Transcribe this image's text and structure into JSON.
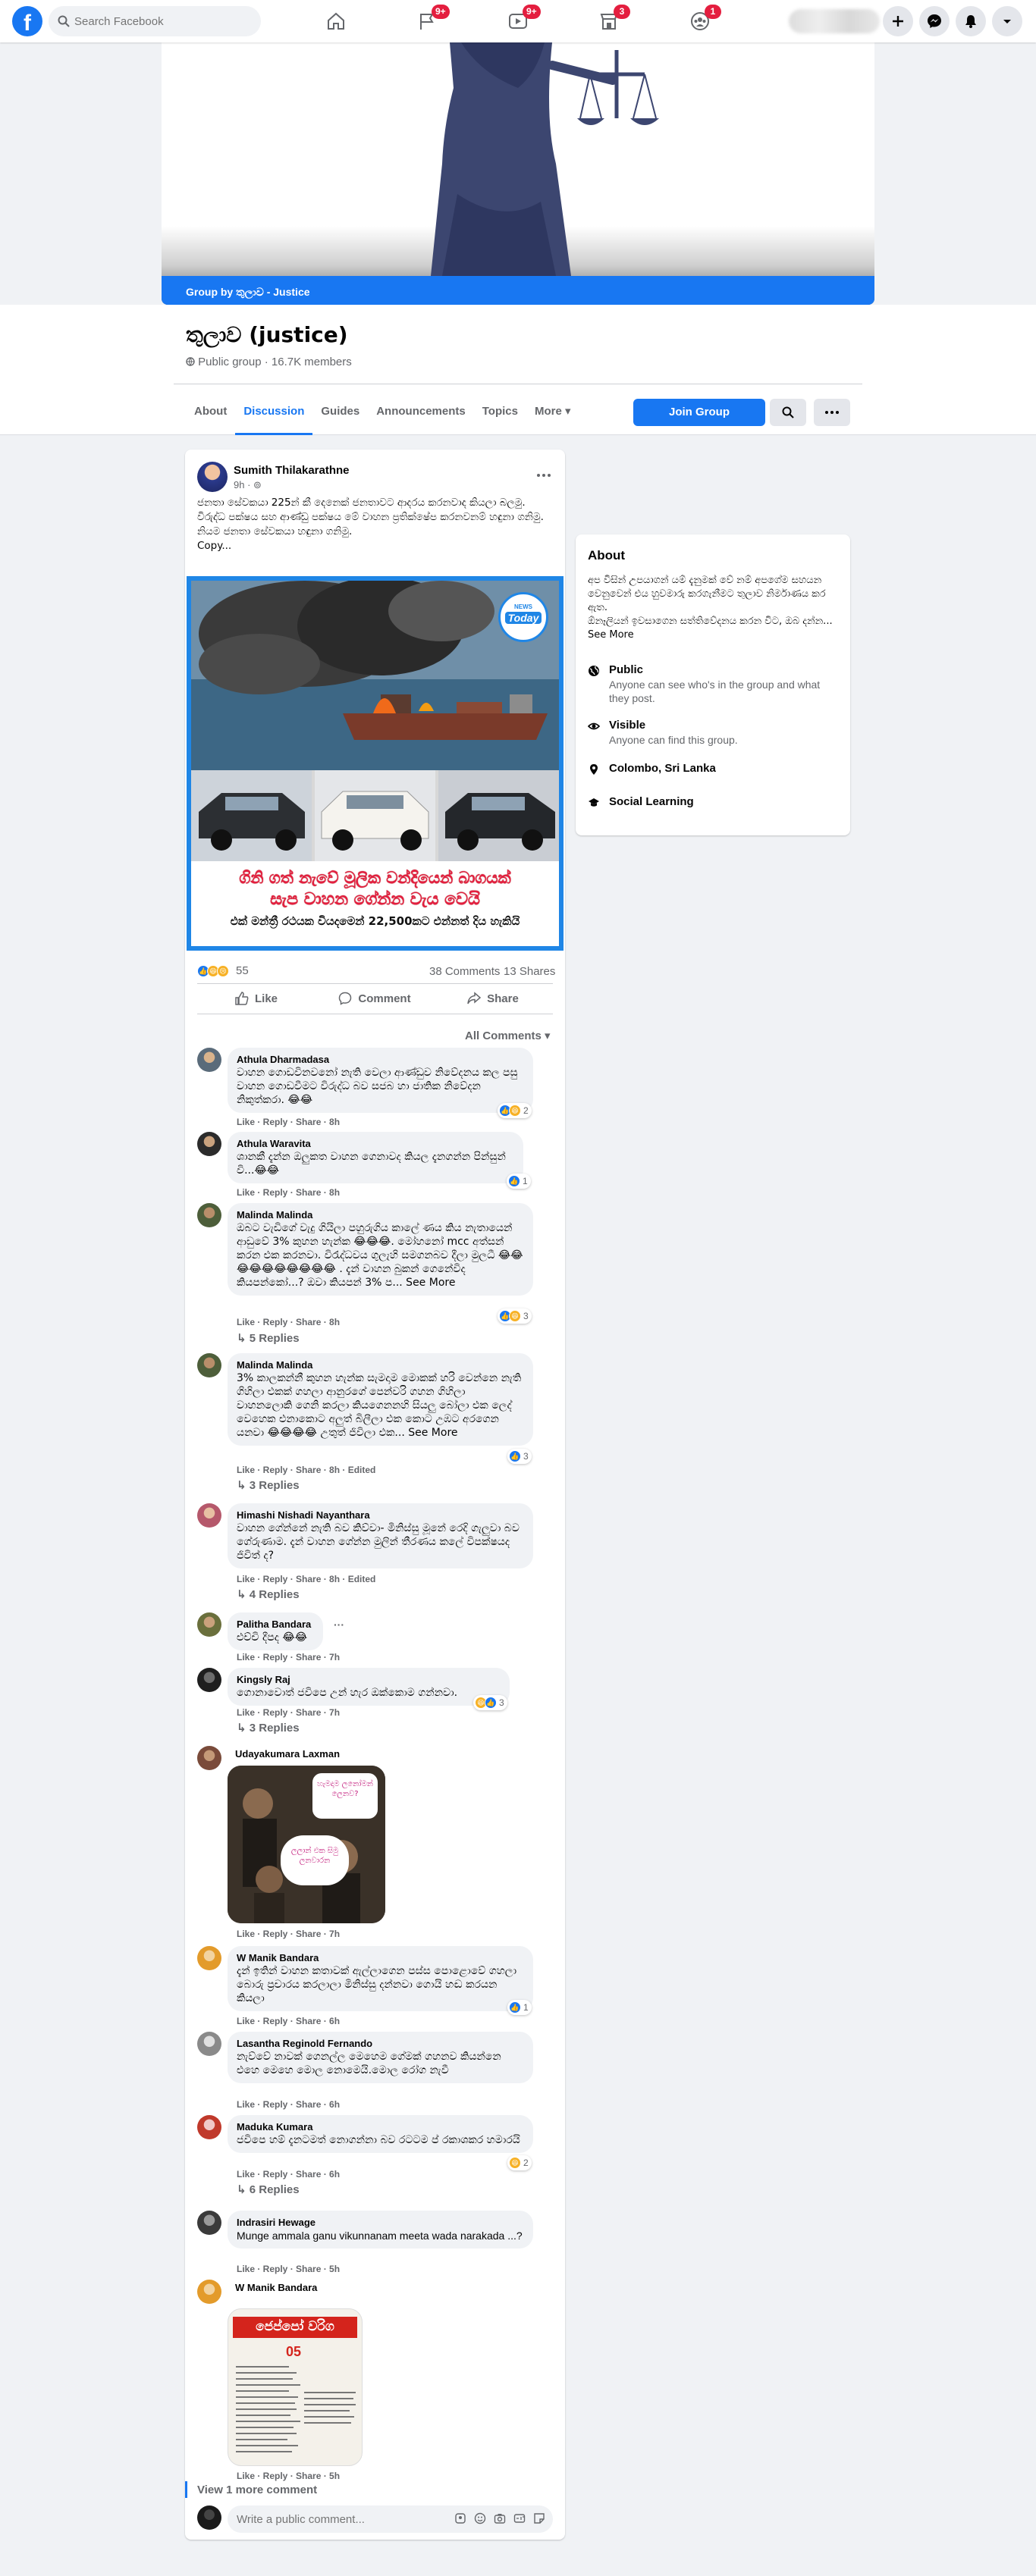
{
  "topbar": {
    "search_placeholder": "Search Facebook",
    "badges": {
      "flag": "9+",
      "video": "9+",
      "market": "3",
      "groups": "1"
    }
  },
  "cover": {
    "bar_text": "Group by තුලාව - Justice"
  },
  "group": {
    "name": "තුලාව (justice)",
    "meta": "Public group · 16.7K members",
    "tabs": [
      "About",
      "Discussion",
      "Guides",
      "Announcements",
      "Topics",
      "More ▾"
    ],
    "join_label": "Join Group"
  },
  "post": {
    "author": "Sumith Thilakarathne",
    "time": "9h · ⊚",
    "text": "ජනතා සේවකයා 225න් කී දෙනෙක් ජනතාවට ආදරය කරනවාද කියලා බලමු.\nවිරුද්ධ පක්ෂය සහ ආණ්ඩු පක්ෂය මේ වාහන ප්‍රතික්ෂේප කරනවනම් හඳුනා ගනිමු. නියම ජනතා සේවකයා හඳුනා ගනිමු.\nCopy...",
    "image_badge": "Today",
    "image_badge_top": "NEWS",
    "image_line1": "ගිනි ගත් නැවේ මූලික වන්දියෙන් බාගයක්",
    "image_line2": "සැප වාහන ගේන්න වැය වෙයි",
    "image_line3": "එක් මන්ත්‍රී රථයක වියදමෙන් 22,500කට එන්නත් දිය හැකියි",
    "reactions_count": "55",
    "comments_count": "38 Comments",
    "shares_count": "13 Shares",
    "like_label": "Like",
    "comment_label": "Comment",
    "share_label": "Share",
    "sort_label": "All Comments ▾"
  },
  "comments": [
    {
      "name": "Athula Dharmadasa",
      "text": "වාහන ගොඩවිනවනෝ නැති වෙලා ආණ්ඩුව නිවේදනය කල පසු වාහන ගොඩවීමට විරුද්ධ බව සජබ හා ජාතික නිවේදන නිකුත්කරා. 😂😂",
      "actions": "Like · Reply · Share · 8h",
      "react": "2"
    },
    {
      "name": "Athula Waravita",
      "text": "ශානකී දැන්න ඔලුකත වාහන ගෙනාවද කියල දැනගන්න පින්සුන් වි...😂😂",
      "actions": "Like · Reply · Share · 8h",
      "react": "1"
    },
    {
      "name": "Malinda Malinda",
      "text": "ඔබට වැඩිගේ වැදු ගියිලා පහුරුගිය කාලේ ණය කිය නැතායෙන් ආඩුවේ 3% කුහන හැන්ක 😂😂😂. මෝහනෝ mcc අත්සන් කරන එක කරනවා. විරැද්ධවය ගුලැහි සමගනබව දීලා මුලධී 😂😂😂😂😂😂😂😂😂😂 . දැන් වාහන බුකන් ගෙනේවිද කියපන්කෝ...? ඔවා කියපන් 3% ප... See More",
      "actions": "Like · Reply · Share · 8h",
      "react": "3",
      "replies": "↳ 5 Replies"
    },
    {
      "name": "Malinda Malinda",
      "text": "3% කාලකන්නී කුහන හැන්ක සැමදාම මොකක් හරි වෙන්නෙ නැති ගිහිලා එකක් ගහලා ආනුරගේ පෙන්වරි ගහන ගිහිලා වාහනලොකි ගෙනි කරලා කියගෙනනහි සියලු බෝලා එක ලෙද් වෙහෙක එනාකොට අලුත් බිලීලා එක කොට උඹට අරගෙන යනවා 😂😂😂😂 උතුත් ජිවිලා එක... See More",
      "actions": "Like · Reply · Share · 8h · Edited",
      "react": "3",
      "replies": "↳ 3 Replies"
    },
    {
      "name": "Himashi Nishadi Nayanthara",
      "text": "වාහන ගේන්නේ නැති බව කිව්වා- මිනිස්සු මූනේ රෙදි ගැලුවා බව ගේරුණාම. දැන් වාහන ගේන්න මුලින් තීරණය කලේ විපක්ෂයද ජිවිත් ද?",
      "actions": "Like · Reply · Share · 8h · Edited",
      "replies": "↳ 4 Replies"
    },
    {
      "name": "Palitha Bandara",
      "text": "එච්චි දීපද 😂😂",
      "actions": "Like · Reply · Share · 7h"
    },
    {
      "name": "Kingsly Raj",
      "text": "ගොනාවොත් ජවිපෙ උන් හැර ඔක්කොම ගන්නවා.",
      "actions": "Like · Reply · Share · 7h",
      "react": "3",
      "replies": "↳ 3 Replies"
    },
    {
      "name": "Udayakumara Laxman",
      "actions": "Like · Reply · Share · 7h",
      "meme_top": "හැමදාම ලනෝමන් ලෙනව?",
      "meme_bottom": "ලලාන් එක සිමු ලනවාරන"
    },
    {
      "name": "W Manik Bandara",
      "text": "දැන් ඉතින් වාහන කතාවක් ඇල්ලාගෙන පස්ස පොළොවේ ගහලා බොරු ප්‍රචාරය කරලාලා මිනිස්සු දන්නවා ගොයි හඬ කරයන කියලා",
      "actions": "Like · Reply · Share · 6h",
      "react": "1"
    },
    {
      "name": "Lasantha Reginold Fernando",
      "text": "නැව්වේ නාවක් ගෙනල්ල මෙහෙම ගේමක් ගහනව කියන්නෙ එහෙ මෙහෙ මොල නොමෙයි.මොල රෝග නැවී",
      "actions": "Like · Reply · Share · 6h"
    },
    {
      "name": "Maduka Kumara",
      "text": "ජවිපෙ හම් දැනටමත් නොගන්නා බව රටටම ප් රකාශකර හමාරයි",
      "actions": "Like · Reply · Share · 6h",
      "react": "2",
      "replies": "↳ 6 Replies"
    },
    {
      "name": "Indrasiri Hewage",
      "text": "Munge ammala ganu vikunnanam meeta wada narakada ...?",
      "actions": "Like · Reply · Share · 5h"
    },
    {
      "name": "W Manik Bandara",
      "actions": "Like · Reply · Share · 5h",
      "paper_title": "ජෙප්පෝ වරිග",
      "paper_num": "05"
    }
  ],
  "view_more": "View 1 more comment",
  "write_placeholder": "Write a public comment...",
  "about": {
    "title": "About",
    "desc": "අප විසින් උපයාගන් යම් දැනුමක් වේ නම් අපගේම සහයන වෙනුවෙන් එය හුවමාරු කරගැනීමට තුලාව නිර්මාණය කර ඇත.\nඕනෑලියන් ඉවසාගෙන සත්තිවේදනය කරන විට, ඔබ දන්න... See More",
    "items": [
      {
        "title": "Public",
        "desc": "Anyone can see who's in the group and what they post."
      },
      {
        "title": "Visible",
        "desc": "Anyone can find this group."
      },
      {
        "title": "Colombo, Sri Lanka",
        "desc": ""
      },
      {
        "title": "Social Learning",
        "desc": ""
      }
    ]
  },
  "colors": {
    "brand": "#1877f2",
    "badge": "#e41e3f",
    "bg": "#f0f2f5"
  }
}
